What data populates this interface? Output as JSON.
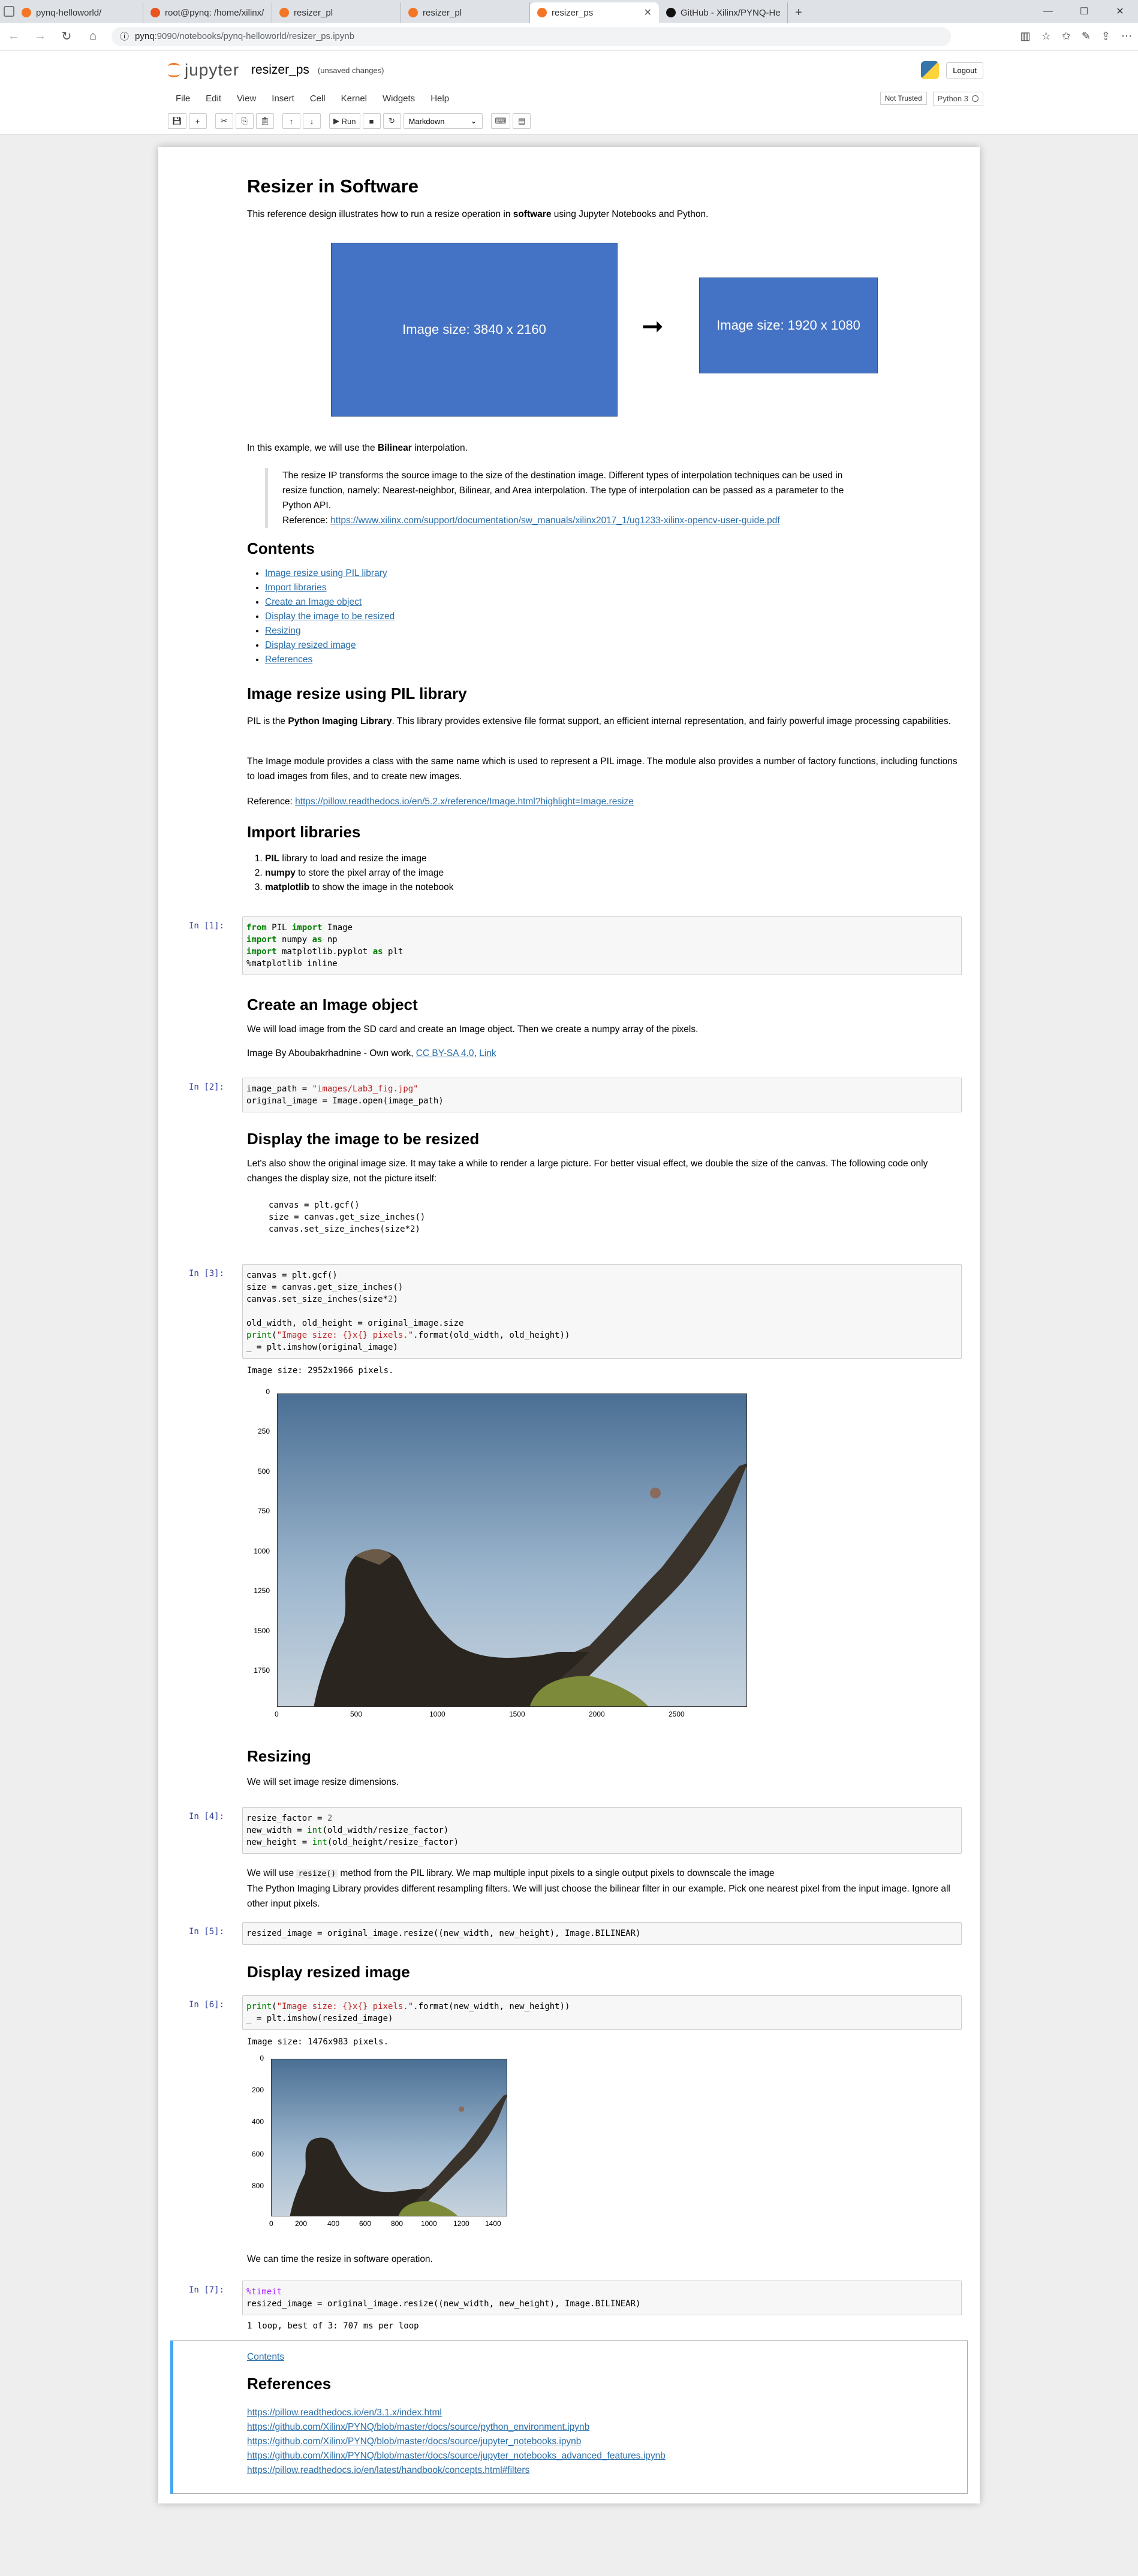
{
  "browser": {
    "tabs": [
      {
        "label": "pynq-helloworld/",
        "icon": "jupyter-icon"
      },
      {
        "label": "root@pynq: /home/xilinx/ju",
        "icon": "terminal-icon"
      },
      {
        "label": "resizer_pl",
        "icon": "jupyter-icon"
      },
      {
        "label": "resizer_pl",
        "icon": "jupyter-icon"
      },
      {
        "label": "resizer_ps",
        "icon": "jupyter-icon"
      },
      {
        "label": "GitHub - Xilinx/PYNQ-Hello",
        "icon": "github-icon"
      }
    ],
    "url_host": "pynq",
    "url_path": ":9090/notebooks/pynq-helloworld/resizer_ps.ipynb",
    "url_info": "ⓘ"
  },
  "jupyter": {
    "logo_text": "jupyter",
    "notebook_name": "resizer_ps",
    "save_status": "(unsaved changes)",
    "logout": "Logout",
    "menu": [
      "File",
      "Edit",
      "View",
      "Insert",
      "Cell",
      "Kernel",
      "Widgets",
      "Help"
    ],
    "trusted": "Not Trusted",
    "kernel_name": "Python 3",
    "toolbar": {
      "run_label": "Run",
      "cell_type": "Markdown"
    }
  },
  "notebook": {
    "title": "Resizer in Software",
    "intro_pre": "This reference design illustrates how to run a resize operation in ",
    "intro_bold": "software",
    "intro_post": " using Jupyter Notebooks and Python.",
    "diagram": {
      "source_label": "Image size: 3840 x 2160",
      "dest_label": "Image size: 1920 x 1080",
      "arrow": "➞"
    },
    "interp_pre": "In this example, we will use the ",
    "interp_bold": "Bilinear",
    "interp_post": " interpolation.",
    "quote_text": "The resize IP transforms the source image to the size of the destination image. Different types of interpolation techniques can be used in resize function, namely: Nearest-neighbor, Bilinear, and Area interpolation. The type of interpolation can be passed as a parameter to the Python API.",
    "quote_ref_label": "Reference: ",
    "quote_ref_link": "https://www.xilinx.com/support/documentation/sw_manuals/xilinx2017_1/ug1233-xilinx-opencv-user-guide.pdf",
    "contents_heading": "Contents",
    "contents": [
      "Image resize using PIL library",
      "Import libraries",
      "Create an Image object",
      "Display the image to be resized",
      "Resizing",
      "Display resized image",
      "References"
    ],
    "pil_heading": "Image resize using PIL library",
    "pil_p1_pre": "PIL is the ",
    "pil_p1_bold": "Python Imaging Library",
    "pil_p1_post": ". This library provides extensive file format support, an efficient internal representation, and fairly powerful image processing capabilities.",
    "pil_p2": "The Image module provides a class with the same name which is used to represent a PIL image. The module also provides a number of factory functions, including functions to load images from files, and to create new images.",
    "pil_ref_label": "Reference: ",
    "pil_ref_link": "https://pillow.readthedocs.io/en/5.2.x/reference/Image.html?highlight=Image.resize",
    "import_heading": "Import libraries",
    "import_list": [
      {
        "bold": "PIL",
        "text": " library to load and resize the image"
      },
      {
        "bold": "numpy",
        "text": " to store the pixel array of the image"
      },
      {
        "bold": "matplotlib",
        "text": " to show the image in the notebook"
      }
    ],
    "create_heading": "Create an Image object",
    "create_p1": "We will load image from the SD card and create an Image object. Then we create a numpy array of the pixels.",
    "create_p2_pre": "Image By Aboubakrhadnine - Own work, ",
    "create_p2_link1": "CC BY-SA 4.0",
    "create_p2_sep": ", ",
    "create_p2_link2": "Link",
    "display_heading": "Display the image to be resized",
    "display_p1": "Let's also show the original image size. It may take a while to render a large picture. For better visual effect, we double the size of the canvas. The following code only changes the display size, not the picture itself:",
    "display_code": "canvas = plt.gcf()\nsize = canvas.get_size_inches()\ncanvas.set_size_inches(size*2)",
    "resizing_heading": "Resizing",
    "resizing_p1": "We will set image resize dimensions.",
    "resize_note_pre": "We will use ",
    "resize_note_code": "resize()",
    "resize_note_post": " method from the PIL library. We map multiple input pixels to a single output pixels to downscale the image",
    "resize_note_2": "The Python Imaging Library provides different resampling filters. We will just choose the bilinear filter in our example. Pick one nearest pixel from the input image. Ignore all other input pixels.",
    "display_resized_heading": "Display resized image",
    "time_note": "We can time the resize in software operation.",
    "contents_link": "Contents",
    "references_heading": "References",
    "references": [
      "https://pillow.readthedocs.io/en/3.1.x/index.html",
      "https://github.com/Xilinx/PYNQ/blob/master/docs/source/python_environment.ipynb",
      "https://github.com/Xilinx/PYNQ/blob/master/docs/source/jupyter_notebooks.ipynb",
      "https://github.com/Xilinx/PYNQ/blob/master/docs/source/jupyter_notebooks_advanced_features.ipynb",
      "https://pillow.readthedocs.io/en/latest/handbook/concepts.html#filters"
    ]
  },
  "cells": {
    "in1": {
      "prompt": "In [1]:"
    },
    "in2": {
      "prompt": "In [2]:"
    },
    "in3": {
      "prompt": "In [3]:",
      "output": "Image size: 2952x1966 pixels."
    },
    "in4": {
      "prompt": "In [4]:"
    },
    "in5": {
      "prompt": "In [5]:"
    },
    "in6": {
      "prompt": "In [6]:",
      "output": "Image size: 1476x983 pixels."
    },
    "in7": {
      "prompt": "In [7]:",
      "output": "1 loop, best of 3: 707 ms per loop"
    }
  },
  "plots": {
    "original": {
      "x_ticks": [
        "0",
        "500",
        "1000",
        "1500",
        "2000",
        "2500"
      ],
      "y_ticks": [
        "0",
        "250",
        "500",
        "750",
        "1000",
        "1250",
        "1500",
        "1750"
      ]
    },
    "resized": {
      "x_ticks": [
        "0",
        "200",
        "400",
        "600",
        "800",
        "1000",
        "1200",
        "1400"
      ],
      "y_ticks": [
        "0",
        "200",
        "400",
        "600",
        "800"
      ]
    }
  },
  "colors": {
    "link": "#296eaa",
    "prompt": "#303f9f",
    "diagram_blue": "#4472c4",
    "toc_highlight": "#42a5f5"
  }
}
